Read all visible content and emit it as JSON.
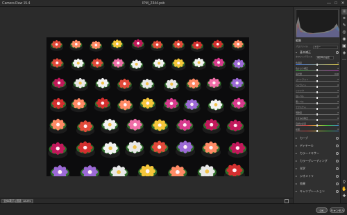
{
  "window": {
    "app_title": "Camera Raw 15.4",
    "doc_title": "IPM_2344.psb",
    "minimize": "—",
    "maximize": "□",
    "close": "✕"
  },
  "panel": {
    "tab_label": "編集",
    "profile_label": "プロファイル",
    "profile_value": "カラー",
    "basic_section": "基本補正",
    "white_balance_label": "ホワイトバランス",
    "white_balance_value": "撮影時の設定",
    "sliders": [
      {
        "name": "色温度",
        "value": "0"
      },
      {
        "name": "色かぶり補正",
        "value": "0"
      },
      {
        "name": "露光量",
        "value": "0.00"
      },
      {
        "name": "コントラスト",
        "value": "0"
      },
      {
        "name": "ハイライト",
        "value": "0"
      },
      {
        "name": "シャドウ",
        "value": "0"
      },
      {
        "name": "白レベル",
        "value": "0"
      },
      {
        "name": "黒レベル",
        "value": "0"
      },
      {
        "name": "テクスチャ",
        "value": "0"
      },
      {
        "name": "明瞭度",
        "value": "0"
      },
      {
        "name": "かすみの除去",
        "value": "0"
      },
      {
        "name": "自然な彩度",
        "value": "0"
      },
      {
        "name": "彩度",
        "value": "0"
      }
    ],
    "sections": [
      "カーブ",
      "ディテール",
      "カラーミキサー",
      "カラーグレーディング",
      "光学",
      "ジオメトリ",
      "効果",
      "キャリブレーション"
    ]
  },
  "status": {
    "zoom_fit": "全体表示 (画面サイズ)",
    "zoom_percent": "18.8%"
  },
  "buttons": {
    "ok": "OK",
    "cancel": "キャンセル"
  },
  "tools": [
    "edit-tool",
    "crop-tool",
    "heal-tool",
    "mask-tool",
    "redeye-tool",
    "snapshot-tool",
    "presets-tool",
    "more-tool",
    "zoom-tool",
    "hand-tool",
    "sample-tool",
    "grid-tool"
  ],
  "colors": {
    "bg": "#2b2b2b",
    "panel": "#303030",
    "accent": "#e0e0e0"
  }
}
